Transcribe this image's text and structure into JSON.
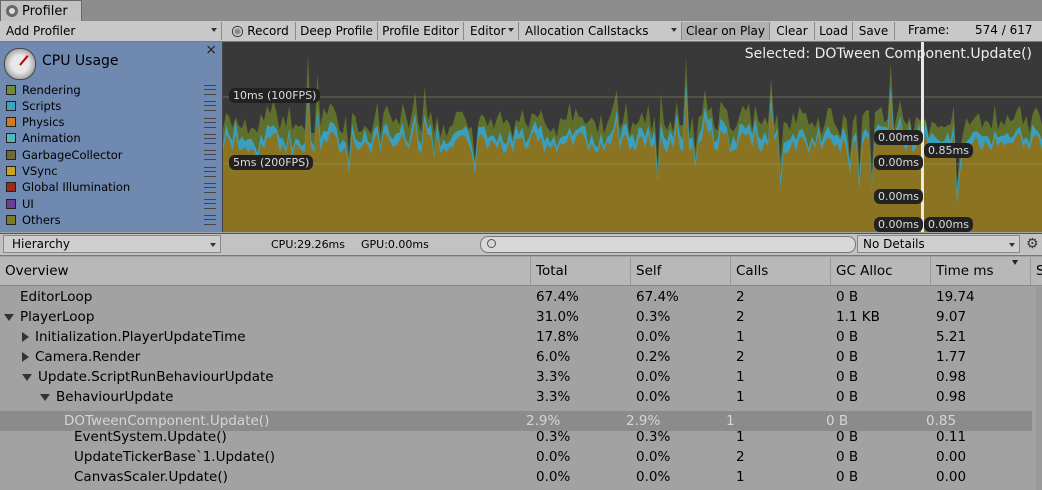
{
  "window": {
    "tab_title": "Profiler"
  },
  "toolbar": {
    "add_profiler": "Add Profiler",
    "record": "Record",
    "deep_profile": "Deep Profile",
    "profile_editor": "Profile Editor",
    "editor": "Editor",
    "allocation_callstacks": "Allocation Callstacks",
    "clear_on_play": "Clear on Play",
    "clear": "Clear",
    "load": "Load",
    "save": "Save",
    "frame_label": "Frame:",
    "frame_value": "574 / 617"
  },
  "cpu_panel": {
    "title": "CPU Usage",
    "close": "×",
    "legend": [
      {
        "label": "Rendering",
        "color": "#6f8a3a"
      },
      {
        "label": "Scripts",
        "color": "#3ba4c2"
      },
      {
        "label": "Physics",
        "color": "#d07a25"
      },
      {
        "label": "Animation",
        "color": "#4fb9c0"
      },
      {
        "label": "GarbageCollector",
        "color": "#6a6a3a"
      },
      {
        "label": "VSync",
        "color": "#c7a322"
      },
      {
        "label": "Global Illumination",
        "color": "#9b2a1e"
      },
      {
        "label": "UI",
        "color": "#6b3f99"
      },
      {
        "label": "Others",
        "color": "#7a7a28"
      }
    ]
  },
  "graph": {
    "selected": "Selected: DOTween Component.Update()",
    "line_10ms": "10ms (100FPS)",
    "line_5ms": "5ms (200FPS)",
    "labels": [
      "0.00ms",
      "0.85ms",
      "0.00ms",
      "0.00ms",
      "0.00ms",
      "0.00ms"
    ]
  },
  "details_bar": {
    "view": "Hierarchy",
    "cpu": "CPU:29.26ms",
    "gpu": "GPU:0.00ms",
    "search_placeholder": "",
    "details": "No Details"
  },
  "table": {
    "headers": [
      "Overview",
      "Total",
      "Self",
      "Calls",
      "GC Alloc",
      "Time ms",
      "S"
    ],
    "rows": [
      {
        "name": "EditorLoop",
        "fold": "",
        "indent": 0,
        "total": "67.4%",
        "self": "67.4%",
        "calls": "2",
        "gc": "0 B",
        "time": "19.74"
      },
      {
        "name": "PlayerLoop",
        "fold": "open",
        "indent": 0,
        "total": "31.0%",
        "self": "0.3%",
        "calls": "2",
        "gc": "1.1 KB",
        "time": "9.07"
      },
      {
        "name": "Initialization.PlayerUpdateTime",
        "fold": "closed",
        "indent": 1,
        "total": "17.8%",
        "self": "0.0%",
        "calls": "1",
        "gc": "0 B",
        "time": "5.21"
      },
      {
        "name": "Camera.Render",
        "fold": "closed",
        "indent": 1,
        "total": "6.0%",
        "self": "0.2%",
        "calls": "2",
        "gc": "0 B",
        "time": "1.77"
      },
      {
        "name": "Update.ScriptRunBehaviourUpdate",
        "fold": "open",
        "indent": 1,
        "total": "3.3%",
        "self": "0.0%",
        "calls": "1",
        "gc": "0 B",
        "time": "0.98"
      },
      {
        "name": "BehaviourUpdate",
        "fold": "open",
        "indent": 2,
        "total": "3.3%",
        "self": "0.0%",
        "calls": "1",
        "gc": "0 B",
        "time": "0.98"
      },
      {
        "name": "DOTweenComponent.Update()",
        "fold": "",
        "indent": 3,
        "total": "2.9%",
        "self": "2.9%",
        "calls": "1",
        "gc": "0 B",
        "time": "0.85",
        "selected": true
      },
      {
        "name": "EventSystem.Update()",
        "fold": "",
        "indent": 3,
        "total": "0.3%",
        "self": "0.3%",
        "calls": "1",
        "gc": "0 B",
        "time": "0.11"
      },
      {
        "name": "UpdateTickerBase`1.Update()",
        "fold": "",
        "indent": 3,
        "total": "0.0%",
        "self": "0.0%",
        "calls": "2",
        "gc": "0 B",
        "time": "0.00"
      },
      {
        "name": "CanvasScaler.Update()",
        "fold": "",
        "indent": 3,
        "total": "0.0%",
        "self": "0.0%",
        "calls": "1",
        "gc": "0 B",
        "time": "0.00"
      }
    ]
  }
}
